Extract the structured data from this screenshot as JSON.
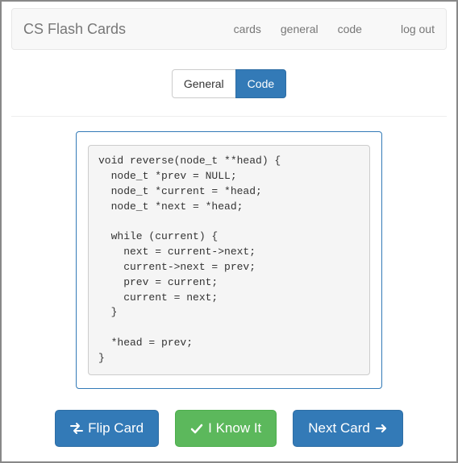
{
  "navbar": {
    "brand": "CS Flash Cards",
    "links": [
      "cards",
      "general",
      "code",
      "log out"
    ]
  },
  "toggle": {
    "general_label": "General",
    "code_label": "Code",
    "active": "code"
  },
  "card": {
    "code": "void reverse(node_t **head) {\n  node_t *prev = NULL;\n  node_t *current = *head;\n  node_t *next = *head;\n\n  while (current) {\n    next = current->next;\n    current->next = prev;\n    prev = current;\n    current = next;\n  }\n\n  *head = prev;\n}"
  },
  "actions": {
    "flip_label": "Flip Card",
    "know_label": "I Know It",
    "next_label": "Next Card"
  }
}
